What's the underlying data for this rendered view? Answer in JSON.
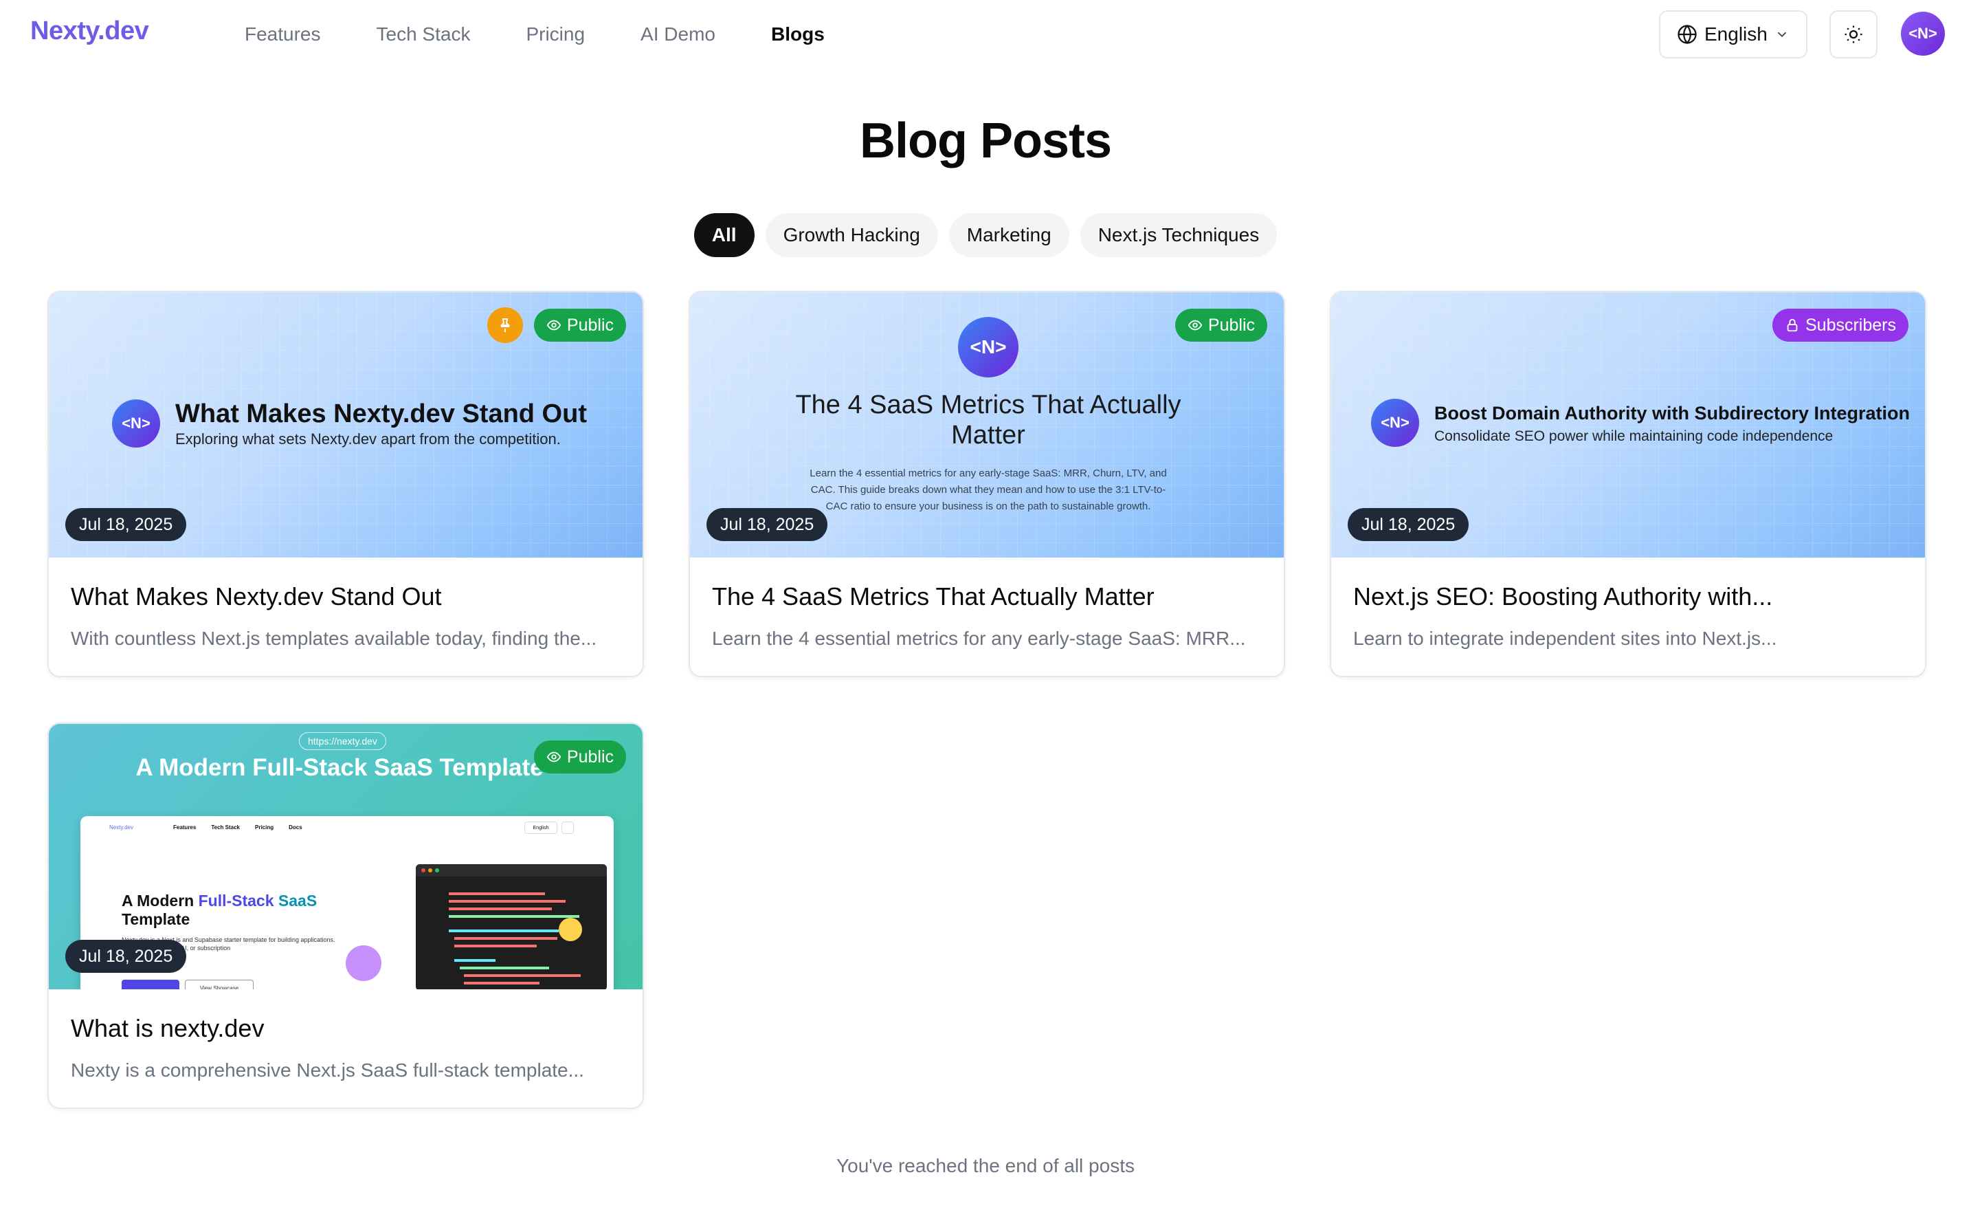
{
  "header": {
    "logo": "Nexty.dev",
    "nav": [
      "Features",
      "Tech Stack",
      "Pricing",
      "AI Demo",
      "Blogs"
    ],
    "active_nav": "Blogs",
    "language": "English",
    "avatar_text": "<N>"
  },
  "page": {
    "title": "Blog Posts",
    "end_text": "You've reached the end of all posts"
  },
  "filters": [
    "All",
    "Growth Hacking",
    "Marketing",
    "Next.js Techniques"
  ],
  "active_filter": "All",
  "posts": [
    {
      "title": "What Makes Nexty.dev Stand Out",
      "description": "With countless Next.js templates available today, finding the...",
      "date": "Jul 18, 2025",
      "visibility": "Public",
      "pinned": true,
      "thumb": {
        "logo": "<N>",
        "heading": "What Makes Nexty.dev Stand Out",
        "subheading": "Exploring what sets Nexty.dev apart from the competition."
      }
    },
    {
      "title": "The 4 SaaS Metrics That Actually Matter",
      "description": "Learn the 4 essential metrics for any early-stage SaaS: MRR...",
      "date": "Jul 18, 2025",
      "visibility": "Public",
      "pinned": false,
      "thumb": {
        "logo": "<N>",
        "heading": "The 4 SaaS Metrics That Actually Matter",
        "subheading": "Learn the 4 essential metrics for any early-stage SaaS: MRR, Churn, LTV, and CAC. This guide breaks down what they mean and how to use the 3:1 LTV-to-CAC ratio to ensure your business is on the path to sustainable growth."
      }
    },
    {
      "title": "Next.js SEO: Boosting Authority with...",
      "description": "Learn to integrate independent sites into Next.js...",
      "date": "Jul 18, 2025",
      "visibility": "Subscribers",
      "pinned": false,
      "thumb": {
        "logo": "<N>",
        "heading": "Boost Domain Authority with Subdirectory Integration",
        "subheading": "Consolidate SEO power while maintaining code independence"
      }
    },
    {
      "title": "What is nexty.dev",
      "description": "Nexty is a comprehensive Next.js SaaS full-stack template...",
      "date": "Jul 18, 2025",
      "visibility": "Public",
      "pinned": false,
      "thumb": {
        "url": "https://nexty.dev",
        "heading": "A Modern Full-Stack SaaS Template",
        "mini_nav": [
          "Nexty.dev",
          "Features",
          "Tech Stack",
          "Pricing",
          "Docs"
        ],
        "mini_lang": "English",
        "hero_line1": "A Modern ",
        "hero_grad1": "Full-Stack ",
        "hero_grad2": "SaaS",
        "hero_line2": "Template",
        "hero_sub": "Nexty.dev is a Next.js and Supabase starter template for building applications. Launch your content, AI, or subscription",
        "btn2": "View Showcase"
      }
    }
  ],
  "colors": {
    "brand": "#6d5ce8",
    "public_badge": "#16a34a",
    "subscribers_badge": "#9333ea",
    "pin_badge": "#f59e0b",
    "date_badge": "#1f2937"
  }
}
